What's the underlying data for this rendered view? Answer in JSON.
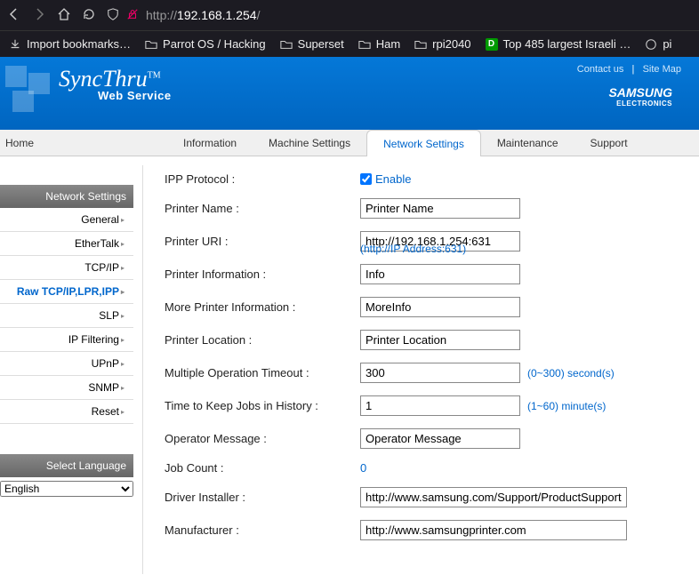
{
  "browser": {
    "url_protocol": "http://",
    "url_host": "192.168.1.254",
    "url_path": "/"
  },
  "bookmarks": {
    "import": "Import bookmarks…",
    "folders": [
      "Parrot OS / Hacking",
      "Superset",
      "Ham",
      "rpi2040"
    ],
    "link1": "Top 485 largest Israeli …",
    "link2": "pi"
  },
  "header": {
    "contact": "Contact us",
    "sitemap": "Site Map",
    "brand": "SyncThru",
    "brand_sub": "Web Service",
    "samsung": "SAMSUNG",
    "samsung_sub": "ELECTRONICS"
  },
  "nav": {
    "home": "Home",
    "information": "Information",
    "machine": "Machine Settings",
    "network": "Network Settings",
    "maintenance": "Maintenance",
    "support": "Support"
  },
  "sidebar": {
    "title": "Network Settings",
    "items": [
      "General",
      "EtherTalk",
      "TCP/IP",
      "Raw TCP/IP,LPR,IPP",
      "SLP",
      "IP Filtering",
      "UPnP",
      "SNMP",
      "Reset"
    ],
    "active_index": 3,
    "lang_title": "Select Language",
    "lang_value": "English"
  },
  "form": {
    "ipp_label": "IPP Protocol :",
    "enable_label": "Enable",
    "printer_name_label": "Printer Name :",
    "printer_name": "Printer Name",
    "printer_uri_label": "Printer URI :",
    "printer_uri": "http://192.168.1.254:631",
    "printer_uri_hint": "(http://IP Address:631)",
    "printer_info_label": "Printer Information :",
    "printer_info": "Info",
    "more_info_label": "More Printer Information :",
    "more_info": "MoreInfo",
    "location_label": "Printer Location :",
    "location": "Printer Location",
    "timeout_label": "Multiple Operation Timeout :",
    "timeout": "300",
    "timeout_hint": "(0~300) second(s)",
    "history_label": "Time to Keep Jobs in History :",
    "history": "1",
    "history_hint": "(1~60) minute(s)",
    "operator_label": "Operator Message :",
    "operator": "Operator Message",
    "jobcount_label": "Job Count :",
    "jobcount": "0",
    "driver_label": "Driver Installer :",
    "driver": "http://www.samsung.com/Support/ProductSupport",
    "manufacturer_label": "Manufacturer :",
    "manufacturer": "http://www.samsungprinter.com"
  }
}
